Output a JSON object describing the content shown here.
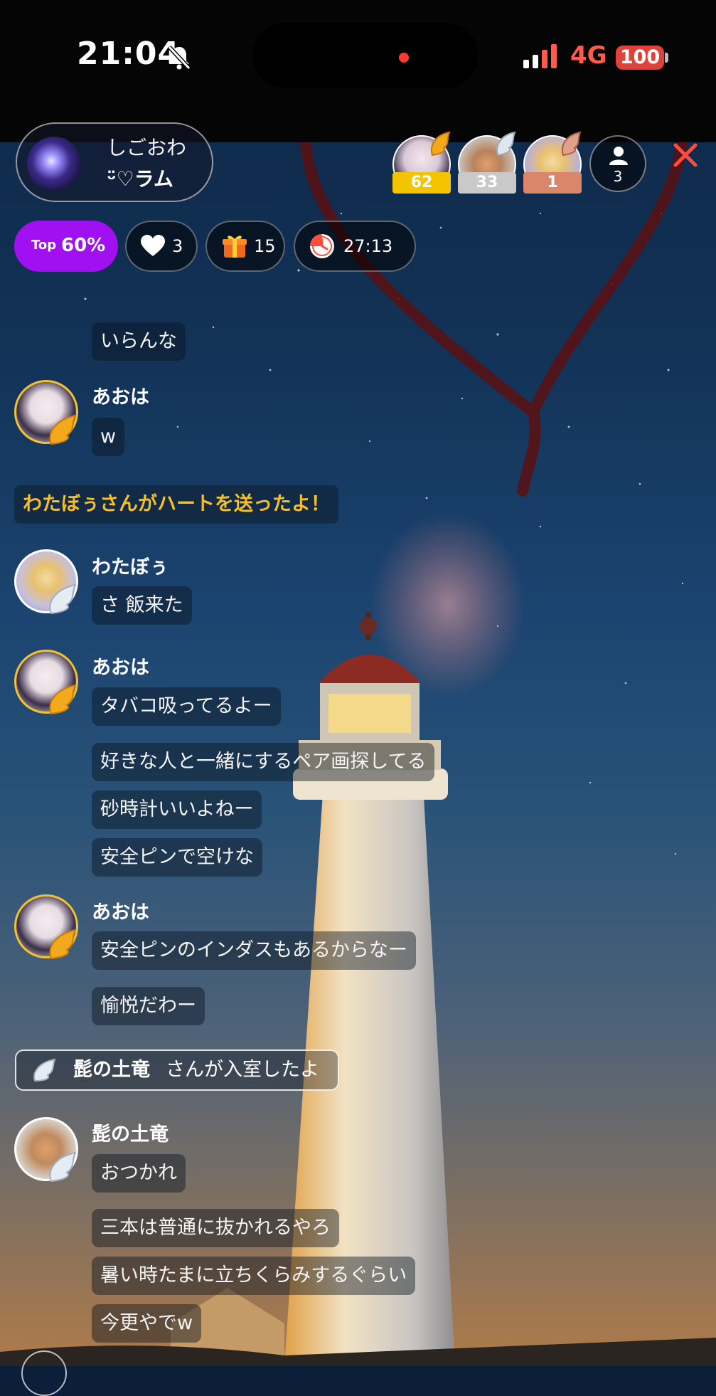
{
  "status_bar": {
    "time": "21:04",
    "network": "4G",
    "battery": "100"
  },
  "host": {
    "name_line1": "しごおわ",
    "name_line2": "ᵕ̈♡ラム"
  },
  "top_viewers": [
    {
      "count": "62",
      "badge_color": "#f5c400"
    },
    {
      "count": "33",
      "badge_color": "#c9c9c9"
    },
    {
      "count": "1",
      "badge_color": "#d9866a"
    }
  ],
  "viewer_count": "3",
  "stats": {
    "top_small": "Top",
    "top_percent": "60%",
    "hearts": "3",
    "gifts": "15",
    "timer": "27:13"
  },
  "chat": {
    "first_message": "いらんな",
    "group1": {
      "user": "あおは",
      "messages": [
        "w"
      ]
    },
    "system_message": "わたぼぅさんがハートを送ったよ！",
    "group2": {
      "user": "わたぼぅ",
      "messages": [
        "さ 飯来た"
      ]
    },
    "group3": {
      "user": "あおは",
      "messages": [
        "タバコ吸ってるよー",
        "好きな人と一緒にするペア画探してる",
        "砂時計いいよねー",
        "安全ピンで空けな"
      ]
    },
    "group4": {
      "user": "あおは",
      "messages": [
        "安全ピンのインダスもあるからなー",
        "愉悦だわー"
      ]
    },
    "join": {
      "name": "髭の土竜",
      "text": "さんが入室したよ"
    },
    "group5": {
      "user": "髭の土竜",
      "messages": [
        "おつかれ",
        "三本は普通に抜かれるやろ",
        "暑い時たまに立ちくらみするぐらい",
        "今更やでw"
      ]
    }
  },
  "colors": {
    "top_pill": "#a010f0",
    "system_text": "#f6c024",
    "close": "#ff4d3d",
    "heart_drawing": "#5a1010"
  }
}
